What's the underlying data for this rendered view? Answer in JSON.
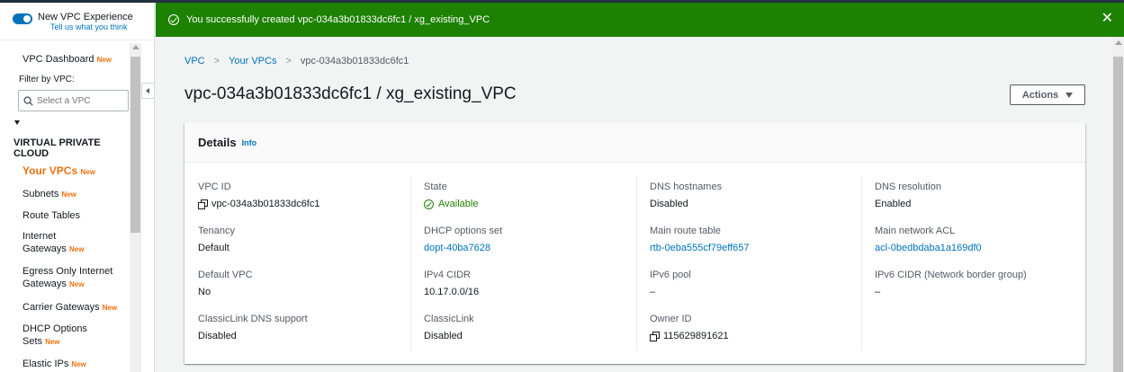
{
  "colors": {
    "accent": "#0073bb",
    "success": "#1d8102",
    "new_badge": "#ec7211"
  },
  "sidebar": {
    "toggle_title": "New VPC Experience",
    "toggle_sub": "Tell us what you think",
    "dashboard": "VPC Dashboard",
    "new_badge": "New",
    "filter_label": "Filter by VPC:",
    "filter_placeholder": "Select a VPC",
    "section_title": "VIRTUAL PRIVATE CLOUD",
    "items": [
      {
        "label": "Your VPCs",
        "new": "New"
      },
      {
        "label": "Subnets",
        "new": "New"
      },
      {
        "label": "Route Tables",
        "new": ""
      },
      {
        "label": "Internet Gateways",
        "new": "New"
      },
      {
        "label": "Egress Only Internet Gateways",
        "new": "New"
      },
      {
        "label": "Carrier Gateways",
        "new": "New"
      },
      {
        "label": "DHCP Options Sets",
        "new": "New"
      },
      {
        "label": "Elastic IPs",
        "new": "New"
      }
    ]
  },
  "flash": {
    "message": "You successfully created vpc-034a3b01833dc6fc1 / xg_existing_VPC",
    "close": "✕"
  },
  "breadcrumb": {
    "root": "VPC",
    "parent": "Your VPCs",
    "current": "vpc-034a3b01833dc6fc1",
    "sep": ">"
  },
  "page": {
    "title": "vpc-034a3b01833dc6fc1 / xg_existing_VPC",
    "actions": "Actions"
  },
  "details": {
    "title": "Details",
    "info": "Info",
    "columns": [
      [
        {
          "label": "VPC ID",
          "value": "vpc-034a3b01833dc6fc1",
          "icon": "copy-icon"
        },
        {
          "label": "Tenancy",
          "value": "Default"
        },
        {
          "label": "Default VPC",
          "value": "No"
        },
        {
          "label": "ClassicLink DNS support",
          "value": "Disabled"
        }
      ],
      [
        {
          "label": "State",
          "value": "Available",
          "icon": "check-circle-icon"
        },
        {
          "label": "DHCP options set",
          "value": "dopt-40ba7628",
          "link": true
        },
        {
          "label": "IPv4 CIDR",
          "value": "10.17.0.0/16"
        },
        {
          "label": "ClassicLink",
          "value": "Disabled"
        }
      ],
      [
        {
          "label": "DNS hostnames",
          "value": "Disabled"
        },
        {
          "label": "Main route table",
          "value": "rtb-0eba555cf79eff657",
          "link": true
        },
        {
          "label": "IPv6 pool",
          "value": "–"
        },
        {
          "label": "Owner ID",
          "value": "115629891621",
          "icon": "copy-icon"
        }
      ],
      [
        {
          "label": "DNS resolution",
          "value": "Enabled"
        },
        {
          "label": "Main network ACL",
          "value": "acl-0bedbdaba1a169df0",
          "link": true
        },
        {
          "label": "IPv6 CIDR (Network border group)",
          "value": "–"
        }
      ]
    ]
  }
}
